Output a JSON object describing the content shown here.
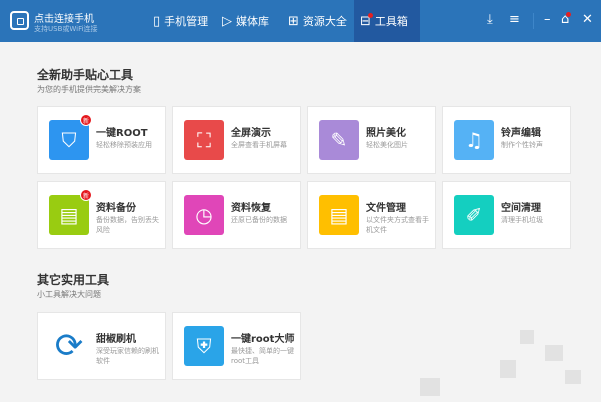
{
  "header": {
    "brand_title": "点击连接手机",
    "brand_subtitle": "支持USB或WiFi连接",
    "tabs": [
      {
        "label": "手机管理",
        "icon": "phone-icon"
      },
      {
        "label": "媒体库",
        "icon": "play-icon"
      },
      {
        "label": "资源大全",
        "icon": "grid-icon"
      },
      {
        "label": "工具箱",
        "icon": "toolbox-icon",
        "active": true
      }
    ],
    "controls": [
      "download-icon",
      "menu-icon",
      "minimize-icon",
      "home-icon",
      "close-icon"
    ]
  },
  "section1": {
    "title": "全新助手贴心工具",
    "subtitle": "为您的手机提供完美解决方案",
    "tools": [
      {
        "title": "一键ROOT",
        "desc": "轻松移除预装应用",
        "color": "#2d95f0",
        "icon": "shield-key-icon",
        "badge": "新"
      },
      {
        "title": "全屏演示",
        "desc": "全屏查看手机屏幕",
        "color": "#e84a4a",
        "icon": "fullscreen-icon"
      },
      {
        "title": "照片美化",
        "desc": "轻松美化图片",
        "color": "#a98ad8",
        "icon": "palette-icon"
      },
      {
        "title": "铃声编辑",
        "desc": "制作个性铃声",
        "color": "#55b2f5",
        "icon": "music-note-icon"
      },
      {
        "title": "资料备份",
        "desc": "备份数据，告别丢失风险",
        "color": "#99cc11",
        "icon": "drawer-icon",
        "badge": "新"
      },
      {
        "title": "资料恢复",
        "desc": "还原已备份的数据",
        "color": "#e046b8",
        "icon": "clock-restore-icon"
      },
      {
        "title": "文件管理",
        "desc": "以文件夹方式查看手机文件",
        "color": "#ffbf00",
        "icon": "folder-icon"
      },
      {
        "title": "空间清理",
        "desc": "清理手机垃圾",
        "color": "#14cfc0",
        "icon": "brush-icon"
      }
    ]
  },
  "section2": {
    "title": "其它实用工具",
    "subtitle": "小工具解决大问题",
    "tools": [
      {
        "title": "甜椒刷机",
        "desc": "深受玩家信赖的刷机软件",
        "color": "#1a7cc8",
        "icon": "refresh-phone-icon"
      },
      {
        "title": "一键root大师",
        "desc": "最快捷、简单的一键root工具",
        "color": "#2aa4e8",
        "icon": "shield-lock-icon"
      }
    ]
  }
}
